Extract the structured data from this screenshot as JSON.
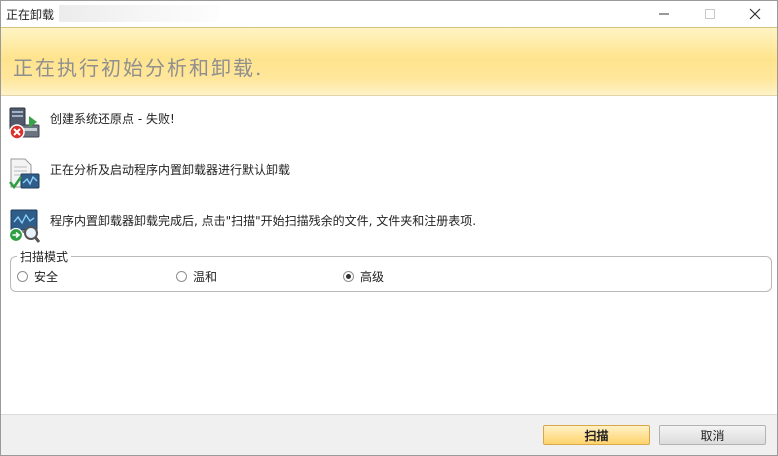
{
  "window": {
    "title": "正在卸载"
  },
  "banner": {
    "heading": "正在执行初始分析和卸载."
  },
  "steps": [
    {
      "text": "创建系统还原点 - 失败!",
      "icon": "restore-point-failed-icon"
    },
    {
      "text": "正在分析及启动程序内置卸载器进行默认卸载",
      "icon": "document-check-icon"
    },
    {
      "text": "程序内置卸载器卸载完成后, 点击\"扫描\"开始扫描残余的文件, 文件夹和注册表项.",
      "icon": "scan-monitor-icon"
    }
  ],
  "scan_mode": {
    "legend": "扫描模式",
    "options": [
      {
        "label": "安全",
        "selected": false
      },
      {
        "label": "温和",
        "selected": false
      },
      {
        "label": "高级",
        "selected": true
      }
    ]
  },
  "buttons": {
    "scan": "扫描",
    "cancel": "取消"
  },
  "colors": {
    "banner_accent": "#ffe48e",
    "scan_button": "#ffd36b"
  }
}
